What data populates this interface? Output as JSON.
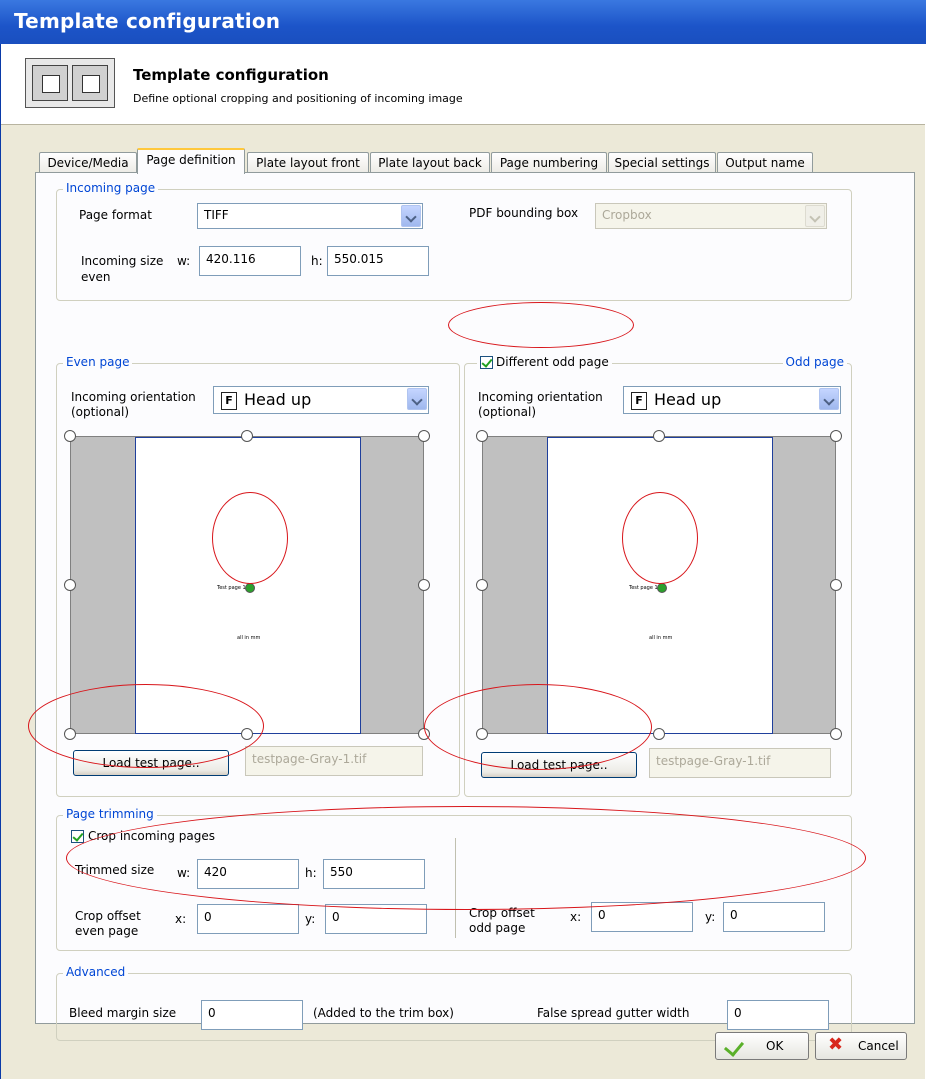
{
  "window": {
    "title": "Template configuration"
  },
  "header": {
    "title": "Template configuration",
    "subtitle": "Define optional cropping and positioning of incoming image"
  },
  "tabs": [
    {
      "label": "Device/Media"
    },
    {
      "label": "Page definition"
    },
    {
      "label": "Plate layout front"
    },
    {
      "label": "Plate layout back"
    },
    {
      "label": "Page numbering"
    },
    {
      "label": "Special settings"
    },
    {
      "label": "Output name"
    }
  ],
  "incoming": {
    "legend": "Incoming page",
    "page_format_label": "Page format",
    "page_format_value": "TIFF",
    "pdf_bbox_label": "PDF bounding box",
    "pdf_bbox_value": "Cropbox",
    "size_label": "Incoming size",
    "size_label2": "even",
    "w_label": "w:",
    "w_value": "420.116",
    "h_label": "h:",
    "h_value": "550.015"
  },
  "even": {
    "legend": "Even page",
    "orientation_label": "Incoming orientation",
    "orientation_label2": "(optional)",
    "orientation_value": "Head up",
    "orientation_icon": "F",
    "load_button": "Load test page..",
    "file_value": "testpage-Gray-1.tif",
    "preview_text": "Test page 1",
    "preview_small": "all in mm"
  },
  "odd": {
    "legend": "Odd page",
    "different_label": "Different odd page",
    "orientation_label": "Incoming orientation",
    "orientation_label2": "(optional)",
    "orientation_value": "Head up",
    "orientation_icon": "F",
    "load_button": "Load test page..",
    "file_value": "testpage-Gray-1.tif",
    "preview_text": "Test page 1",
    "preview_small": "all in mm"
  },
  "trimming": {
    "legend": "Page trimming",
    "crop_label": "Crop incoming pages",
    "trimmed_label": "Trimmed size",
    "w_label": "w:",
    "w_value": "420",
    "h_label": "h:",
    "h_value": "550",
    "even_offset_label": "Crop offset",
    "even_offset_label2": "even page",
    "even_x_label": "x:",
    "even_x_value": "0",
    "even_y_label": "y:",
    "even_y_value": "0",
    "odd_offset_label": "Crop offset",
    "odd_offset_label2": "odd page",
    "odd_x_label": "x:",
    "odd_x_value": "0",
    "odd_y_label": "y:",
    "odd_y_value": "0"
  },
  "advanced": {
    "legend": "Advanced",
    "bleed_label": "Bleed margin size",
    "bleed_value": "0",
    "bleed_note": "(Added to the trim box)",
    "gutter_label": "False spread gutter width",
    "gutter_value": "0"
  },
  "footer": {
    "ok_label": "OK",
    "cancel_label": "Cancel"
  },
  "colors": {
    "title_bar": "#1c54c8",
    "legend": "#0046d5",
    "annotation": "#d8161b"
  }
}
